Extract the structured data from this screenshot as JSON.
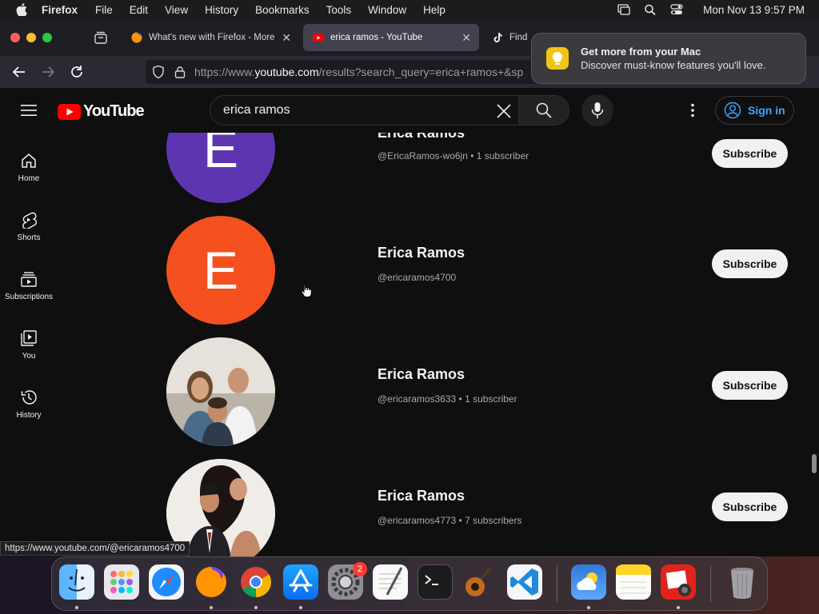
{
  "menubar": {
    "app_name": "Firefox",
    "items": [
      "File",
      "Edit",
      "View",
      "History",
      "Bookmarks",
      "Tools",
      "Window",
      "Help"
    ],
    "clock": "Mon Nov 13  9:57 PM"
  },
  "tabs": [
    {
      "title": "What's new with Firefox - More",
      "favicon": "firefox-icon"
    },
    {
      "title": "erica ramos - YouTube",
      "favicon": "youtube-icon",
      "active": true
    },
    {
      "title": "Find 'e",
      "favicon": "tiktok-icon"
    }
  ],
  "urlbar": {
    "url_prefix": "https://www.",
    "url_domain": "youtube.com",
    "url_rest": "/results?search_query=erica+ramos+&sp"
  },
  "notification": {
    "title": "Get more from your Mac",
    "body": "Discover must-know features you'll love."
  },
  "youtube": {
    "logo_text": "YouTube",
    "search_value": "erica ramos",
    "sign_in": "Sign in"
  },
  "sidebar": {
    "items": [
      {
        "label": "Home",
        "icon": "home-icon"
      },
      {
        "label": "Shorts",
        "icon": "shorts-icon"
      },
      {
        "label": "Subscriptions",
        "icon": "subscriptions-icon"
      },
      {
        "label": "You",
        "icon": "you-icon"
      },
      {
        "label": "History",
        "icon": "history-icon"
      }
    ]
  },
  "results": [
    {
      "name": "Erica Ramos",
      "meta": "@EricaRamos-wo6jn • 1 subscriber",
      "avatar_letter": "E",
      "avatar_color": "#5e35b1"
    },
    {
      "name": "Erica Ramos",
      "meta": "@ericaramos4700",
      "avatar_letter": "E",
      "avatar_color": "#f4511e"
    },
    {
      "name": "Erica Ramos",
      "meta": "@ericaramos3633 • 1 subscriber",
      "avatar_letter": "",
      "avatar_color": "#d9d2c8"
    },
    {
      "name": "Erica Ramos",
      "meta": "@ericaramos4773 • 7 subscribers",
      "avatar_letter": "",
      "avatar_color": "#e5e0da"
    }
  ],
  "subscribe_label": "Subscribe",
  "status_url": "https://www.youtube.com/@ericaramos4700",
  "dock": {
    "badge_count": "2",
    "apps": [
      "finder-icon",
      "launchpad-icon",
      "safari-icon",
      "firefox-icon",
      "chrome-icon",
      "app-store-icon",
      "system-settings-icon",
      "textedit-icon",
      "terminal-icon",
      "garageband-icon",
      "vscode-icon",
      "weather-icon",
      "notes-icon",
      "photo-booth-icon",
      "trash-icon"
    ]
  },
  "colors": {
    "youtube_red": "#ff0000",
    "link_blue": "#3ea6ff",
    "background": "#0f0f0f"
  }
}
